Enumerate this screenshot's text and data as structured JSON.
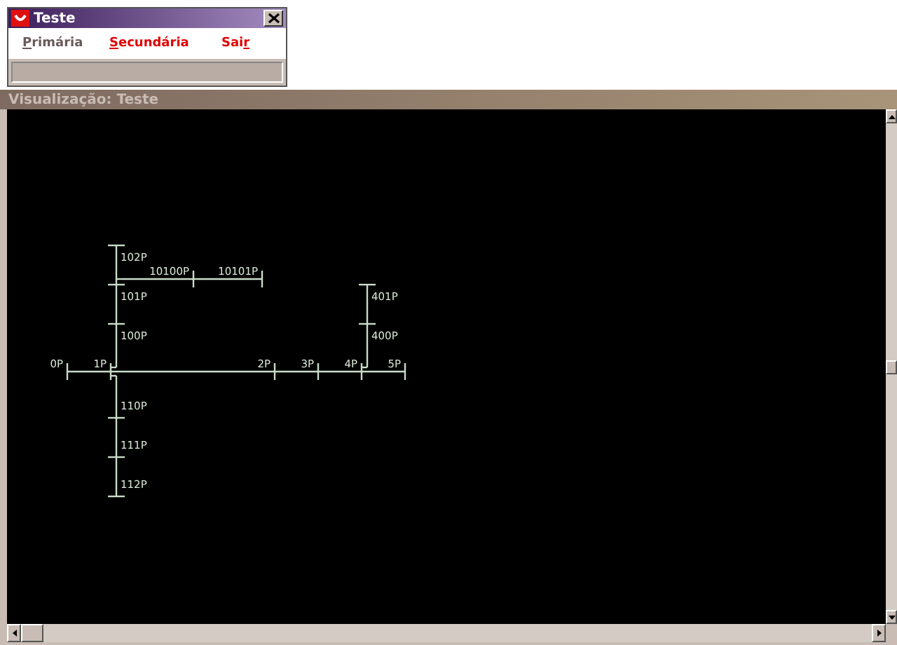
{
  "menu_window": {
    "title": "Teste",
    "menu": [
      {
        "key": "P",
        "after": "rimária",
        "disabled": true
      },
      {
        "key": "S",
        "after": "ecundária",
        "disabled": false
      },
      {
        "before": "Sai",
        "key": "r",
        "disabled": false
      }
    ]
  },
  "view_window": {
    "title": "Visualização: Teste"
  },
  "network": {
    "kind": "horizontal",
    "nodes": [
      {
        "label": "0P"
      },
      {
        "label": "1P",
        "branches": [
          {
            "kind": "upward",
            "nodes": [
              {
                "label": "102P"
              },
              {
                "label": "101P",
                "branches": [
                  {
                    "kind": "horizontal",
                    "nodes": [
                      {
                        "label": "10100P"
                      },
                      {
                        "label": "10101P"
                      }
                    ]
                  }
                ]
              },
              {
                "label": "100P"
              }
            ]
          },
          {
            "kind": "downward",
            "nodes": [
              {
                "label": "110P"
              },
              {
                "label": "111P"
              },
              {
                "label": "112P"
              }
            ]
          }
        ]
      },
      {
        "label": "2P"
      },
      {
        "label": "3P"
      },
      {
        "label": "4P",
        "branches": [
          {
            "kind": "upward",
            "nodes": [
              {
                "label": "401P"
              },
              {
                "label": "400P"
              }
            ]
          }
        ]
      },
      {
        "label": "5P"
      }
    ]
  }
}
